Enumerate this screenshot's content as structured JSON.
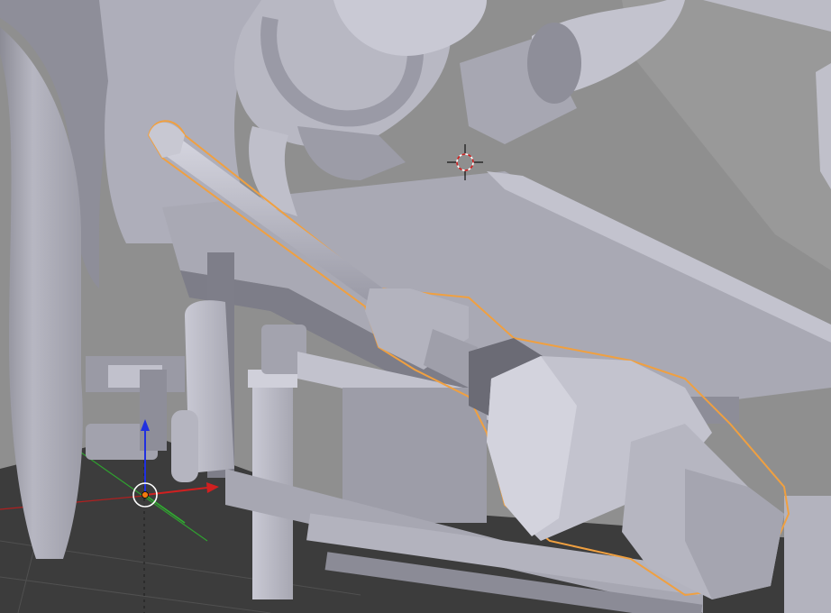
{
  "viewport": {
    "name": "3D Viewport",
    "background_color": "#8f8f8f",
    "floor_color": "#3a3a3a",
    "selection_outline_color": "#f0a040",
    "axis_colors": {
      "x": "#d02020",
      "y": "#30b030",
      "z": "#2030e0"
    },
    "selected_object": "lever-handle",
    "gizmo": "transform-manipulator-icon",
    "cursor": "3d-cursor-icon"
  }
}
